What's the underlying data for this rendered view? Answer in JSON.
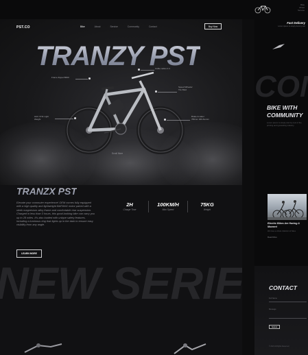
{
  "brand": {
    "logo": "PST.CO"
  },
  "nav": {
    "items": [
      {
        "label": "Bike",
        "active": true
      },
      {
        "label": "About",
        "active": false
      },
      {
        "label": "Service",
        "active": false
      },
      {
        "label": "Community",
        "active": false
      },
      {
        "label": "Contact",
        "active": false
      }
    ],
    "buy_label": "Buy Now"
  },
  "hero": {
    "title": "TRANZY PST",
    "callouts": {
      "frame": "Frame Zippet B600",
      "cable": "Cable radius 2.4",
      "speed": [
        "Speed Wheeler",
        "Tiro Bold"
      ],
      "ac": [
        "HAC 3711 Light",
        "Weight"
      ],
      "brake": [
        "Brake & Hater",
        "780mm 300 Alumin"
      ]
    },
    "scroll_label": "Scroll More"
  },
  "section2": {
    "title": "TRANZX PST",
    "text": "Elevate your commuter experience! OEM comes fully equipped with a high quality and lightweight BAFANG motor paired with a sleek magnesium alloy frame and comfortable rear suspension. Charged in less than 3 hours, this good-looking bike can carry you up to 28 miles. It's also loaded with unique safety features, including a luminous ring that lights up in the dark to ensure easy visibility from any angle.",
    "learn_more": "LEARN MORE",
    "stats": [
      {
        "value": "2H",
        "label": "Charge Time"
      },
      {
        "value": "100KM/H",
        "label": "Max Speed"
      },
      {
        "value": "75KG",
        "label": "Weight"
      }
    ],
    "background_word": "NEW SERIES"
  },
  "right_panel": {
    "header_lines": [
      "Bike",
      "About",
      "Service"
    ],
    "fast_delivery": "Fast Delivery",
    "fast_delivery_sub": "Lorem ipsum is simply dummy text",
    "big_word": "COM",
    "community_title": [
      "BIKE WITH",
      "COMMUNITY"
    ],
    "community_text": "Lorem ipsum is simply dummy text of the printing and typesetting industry.",
    "article_title": [
      "Electric Bikes Are Having A",
      "Moment"
    ],
    "article_text": "We have a whole collection of bikes",
    "article_link": "Read More",
    "contact_title": "CONTACT",
    "contact_fields": [
      "Full Name",
      "Message"
    ],
    "submit": "Submit",
    "footer": "© 2021 All Rights Reserved"
  },
  "colors": {
    "background": "#0d0d0e",
    "panel": "#111113",
    "accent_text": "#ffffff",
    "title_gradient_top": "#d6d8e2",
    "title_gradient_bottom": "#6d7283"
  }
}
